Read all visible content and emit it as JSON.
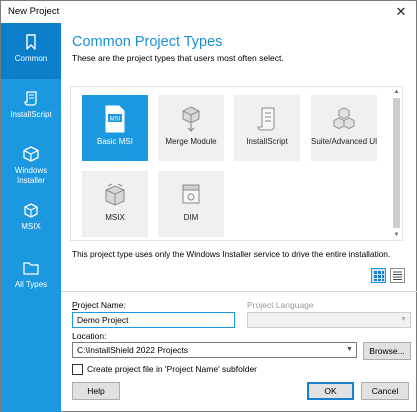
{
  "window": {
    "title": "New Project",
    "close_glyph": "✕"
  },
  "sidebar": {
    "items": [
      {
        "label": "Common",
        "icon": "bookmark-icon",
        "active": true
      },
      {
        "label": "InstallScript",
        "icon": "script-icon"
      },
      {
        "label": "Windows Installer",
        "icon": "package-icon"
      },
      {
        "label": "MSIX",
        "icon": "msix-box-icon"
      },
      {
        "label": "All Types",
        "icon": "folder-icon"
      }
    ]
  },
  "main": {
    "heading": "Common Project Types",
    "subheading": "These are the project types that users most often select.",
    "tiles": [
      {
        "label": "Basic MSI",
        "icon": "msi-icon",
        "badge": "MSI",
        "selected": true
      },
      {
        "label": "Merge Module",
        "icon": "merge-module-icon"
      },
      {
        "label": "InstallScript",
        "icon": "scroll-icon"
      },
      {
        "label": "Suite/Advanced UI",
        "icon": "cubes-icon"
      },
      {
        "label": "MSIX",
        "icon": "msix-box-icon"
      },
      {
        "label": "DIM",
        "icon": "dim-icon"
      }
    ],
    "description": "This project type uses only the Windows Installer service to drive the entire installation.",
    "view_modes": [
      {
        "name": "large-icons",
        "active": true
      },
      {
        "name": "details"
      }
    ]
  },
  "form": {
    "project_name": {
      "label": "Project Name:",
      "value": "Demo Project"
    },
    "project_language": {
      "label": "Project Language",
      "value": ""
    },
    "location": {
      "label": "Location:",
      "value": "C:\\InstallShield 2022 Projects"
    },
    "browse_label": "Browse...",
    "create_subfolder_label": "Create project file in 'Project Name' subfolder",
    "create_subfolder_checked": false
  },
  "footer": {
    "help": "Help",
    "ok": "OK",
    "cancel": "Cancel"
  },
  "colors": {
    "accent": "#1b98e0",
    "heading": "#1b8fd6",
    "sidebar_active": "#0b7fcc",
    "tile_bg": "#f0f0f0"
  }
}
